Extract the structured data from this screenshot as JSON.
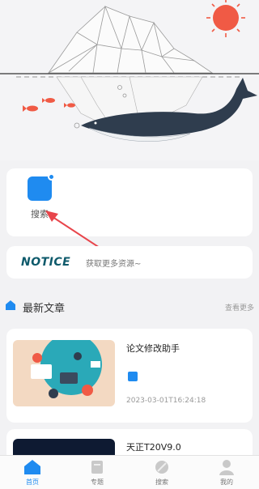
{
  "quick": {
    "items": [
      {
        "label": "搜索"
      }
    ]
  },
  "notice": {
    "title": "NOTICE",
    "text": "获取更多资源~"
  },
  "section": {
    "title": "最新文章",
    "more": "查看更多"
  },
  "articles": [
    {
      "title": "论文修改助手",
      "date": "2023-03-01T16:24:18"
    },
    {
      "title": "天正T20V9.0",
      "date": ""
    }
  ],
  "tabs": [
    {
      "label": "首页",
      "icon": "home-icon",
      "active": true
    },
    {
      "label": "专题",
      "icon": "topic-icon",
      "active": false
    },
    {
      "label": "搜索",
      "icon": "search-icon",
      "active": false
    },
    {
      "label": "我的",
      "icon": "user-icon",
      "active": false
    }
  ],
  "colors": {
    "accent": "#1f8bf0",
    "background": "#f2f2f4",
    "sun": "#f05a45",
    "arrow": "#e8454b"
  }
}
